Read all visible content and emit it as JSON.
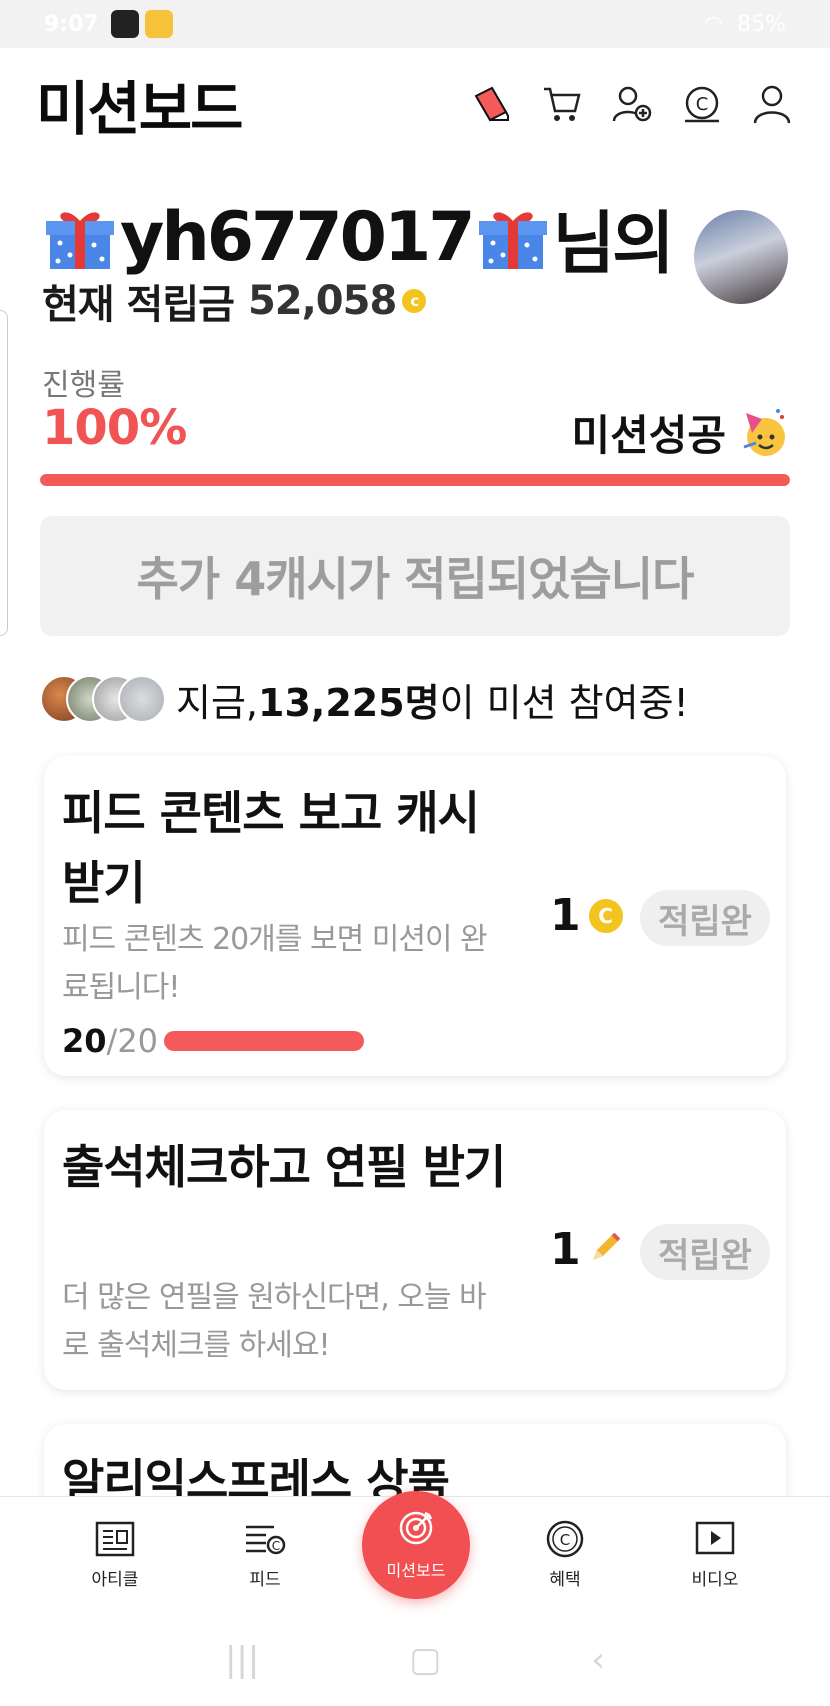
{
  "status_bar": {
    "time": "9:07",
    "battery": "85%"
  },
  "header": {
    "title": "미션보드"
  },
  "user": {
    "name": "yh677017",
    "suffix": "님의"
  },
  "points": {
    "label": "현재 적립금",
    "value": "52,058"
  },
  "progress": {
    "label": "진행률",
    "value": "100%",
    "percent": 100,
    "status": "미션성공"
  },
  "notice": "추가 4캐시가 적립되었습니다",
  "participants": {
    "prefix": "지금, ",
    "count": "13,225명",
    "suffix": "이 미션 참여중!"
  },
  "missions": [
    {
      "title": "피드 콘텐츠 보고 캐시 받기",
      "desc": "피드 콘텐츠 20개를 보면 미션이 완료됩니다!",
      "reward": "1",
      "reward_icon": "coin-icon",
      "status": "적립완",
      "progress_done": "20",
      "progress_total": "/20"
    },
    {
      "title": "출석체크하고 연필 받기",
      "desc": "더 많은 연필을 원하신다면, 오늘 바로 출석체크를 하세요!",
      "reward": "1",
      "reward_icon": "pencil-icon",
      "status": "적립완"
    },
    {
      "title": "알리익스프레스 상품"
    }
  ],
  "bottom_nav": {
    "article": "아티클",
    "feed": "피드",
    "mission": "미션보드",
    "benefit": "혜택",
    "video": "비디오"
  },
  "colors": {
    "accent": "#f24f52",
    "coin": "#f3c31e"
  }
}
